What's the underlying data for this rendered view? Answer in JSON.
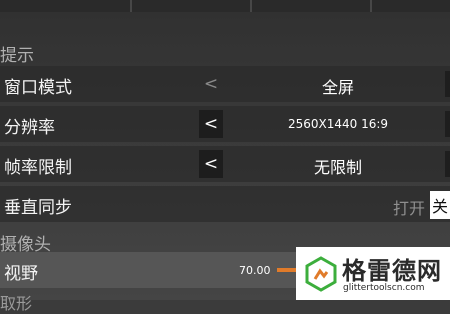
{
  "sections": {
    "display_hint": "提示",
    "camera": "摄像头",
    "partial_next": "取形"
  },
  "rows": {
    "window_mode": {
      "label": "窗口模式",
      "arrow": "<",
      "value": "全屏"
    },
    "resolution": {
      "label": "分辨率",
      "arrow": "<",
      "value": "2560X1440 16:9"
    },
    "frame_limit": {
      "label": "帧率限制",
      "arrow": "<",
      "value": "无限制"
    },
    "vsync": {
      "label": "垂直同步",
      "on_label": "打开",
      "off_label": "关"
    },
    "fov": {
      "label": "视野",
      "value": "70.00"
    }
  },
  "watermark": {
    "title": "格雷德网",
    "url": "glittertoolscn.com"
  },
  "colors": {
    "accent": "#e07b2a",
    "logo_green": "#3cae3c"
  }
}
